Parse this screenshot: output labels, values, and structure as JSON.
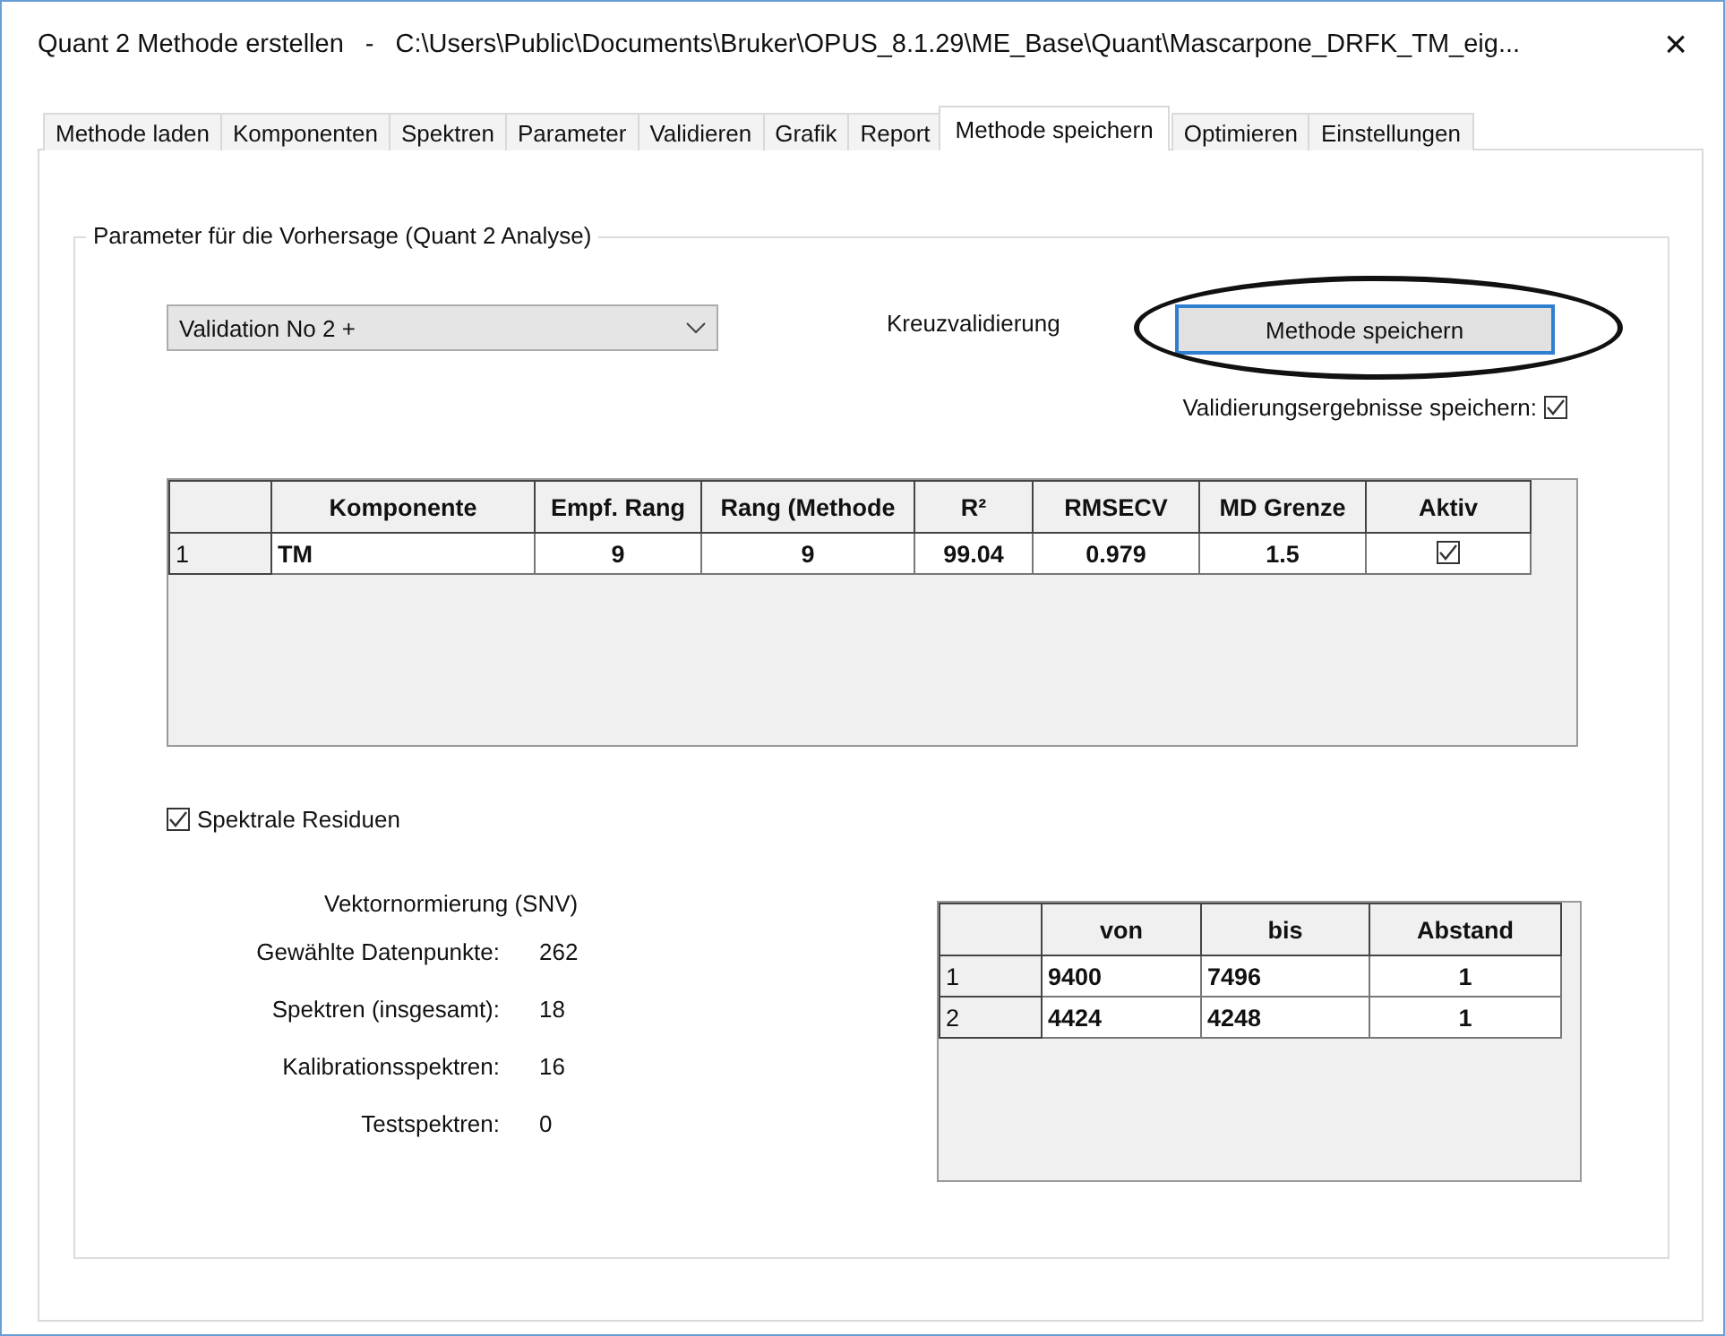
{
  "window": {
    "title": "Quant 2 Methode erstellen",
    "separator": "-",
    "path": "C:\\Users\\Public\\Documents\\Bruker\\OPUS_8.1.29\\ME_Base\\Quant\\Mascarpone_DRFK_TM_eig...",
    "close": "×"
  },
  "tabs": [
    {
      "label": "Methode laden",
      "selected": false
    },
    {
      "label": "Komponenten",
      "selected": false
    },
    {
      "label": "Spektren",
      "selected": false
    },
    {
      "label": "Parameter",
      "selected": false
    },
    {
      "label": "Validieren",
      "selected": false
    },
    {
      "label": "Grafik",
      "selected": false
    },
    {
      "label": "Report",
      "selected": false
    },
    {
      "label": "Methode speichern",
      "selected": true
    },
    {
      "label": "Optimieren",
      "selected": false
    },
    {
      "label": "Einstellungen",
      "selected": false
    }
  ],
  "group": {
    "legend": "Parameter für die Vorhersage (Quant 2 Analyse)",
    "method_select": {
      "value": "Validation No 2 +"
    },
    "validation_label": "Kreuzvalidierung",
    "save_button": "Methode speichern",
    "save_results": {
      "label": "Validierungsergebnisse speichern:",
      "checked": true
    },
    "components_table": {
      "columns": [
        "Komponente",
        "Empf. Rang",
        "Rang (Methode",
        "R²",
        "RMSECV",
        "MD Grenze",
        "Aktiv"
      ],
      "rows": [
        {
          "number": "1",
          "cells": [
            "TM",
            "9",
            "9",
            "99.04",
            "0.979",
            "1.5"
          ],
          "active": true
        }
      ]
    },
    "spectral_residuals": {
      "label": "Spektrale Residuen",
      "checked": true
    },
    "normalization": "Vektornormierung (SNV)",
    "stats": [
      {
        "label": "Gewählte Datenpunkte:",
        "value": "262"
      },
      {
        "label": "Spektren (insgesamt):",
        "value": "18"
      },
      {
        "label": "Kalibrationsspektren:",
        "value": "16"
      },
      {
        "label": "Testspektren:",
        "value": "0"
      }
    ],
    "ranges_table": {
      "columns": [
        "von",
        "bis",
        "Abstand"
      ],
      "rows": [
        {
          "number": "1",
          "cells": [
            "9400",
            "7496",
            "1"
          ]
        },
        {
          "number": "2",
          "cells": [
            "4424",
            "4248",
            "1"
          ]
        }
      ]
    }
  }
}
